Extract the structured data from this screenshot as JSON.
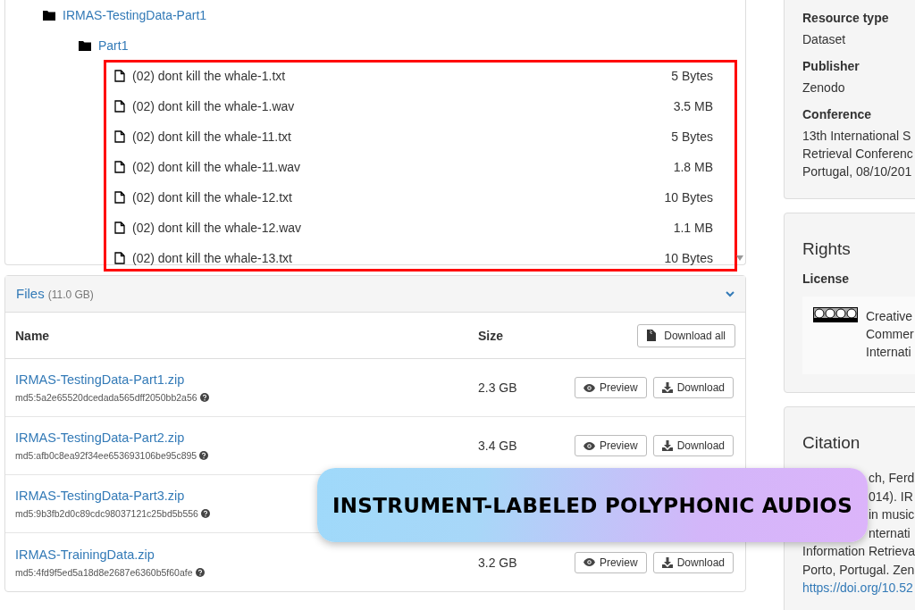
{
  "tree": [
    {
      "name": "IRMAS-TestingData-Part1",
      "kind": "folder",
      "children": [
        {
          "name": "Part1",
          "kind": "folder",
          "children": [
            {
              "name": "(02) dont kill the whale-1.txt",
              "kind": "file",
              "size": "5 Bytes"
            },
            {
              "name": "(02) dont kill the whale-1.wav",
              "kind": "file",
              "size": "3.5 MB"
            },
            {
              "name": "(02) dont kill the whale-11.txt",
              "kind": "file",
              "size": "5 Bytes"
            },
            {
              "name": "(02) dont kill the whale-11.wav",
              "kind": "file",
              "size": "1.8 MB"
            },
            {
              "name": "(02) dont kill the whale-12.txt",
              "kind": "file",
              "size": "10 Bytes"
            },
            {
              "name": "(02) dont kill the whale-12.wav",
              "kind": "file",
              "size": "1.1 MB"
            },
            {
              "name": "(02) dont kill the whale-13.txt",
              "kind": "file",
              "size": "10 Bytes"
            }
          ]
        }
      ]
    }
  ],
  "files": {
    "title": "Files",
    "total": "(11.0 GB)",
    "expanded": true,
    "columns": [
      "Name",
      "Size"
    ],
    "download_all": "Download all",
    "rows": [
      {
        "name": "IRMAS-TestingData-Part1.zip",
        "md5": "md5:5a2e65520dcedada565dff2050bb2a56",
        "size": "2.3 GB",
        "preview": "Preview",
        "download": "Download"
      },
      {
        "name": "IRMAS-TestingData-Part2.zip",
        "md5": "md5:afb0c8ea92f34ee653693106be95c895",
        "size": "3.4 GB",
        "preview": "Preview",
        "download": "Download"
      },
      {
        "name": "IRMAS-TestingData-Part3.zip",
        "md5": "md5:9b3fb2d0c89cdc98037121c25bd5b556"
      },
      {
        "name": "IRMAS-TrainingData.zip",
        "md5": "md5:4fd9f5ed5a18d8e2687e6360b5f60afe",
        "size": "3.2 GB",
        "preview": "Preview",
        "download": "Download"
      }
    ]
  },
  "details": [
    {
      "label": "Resource type",
      "lines": [
        "Dataset"
      ]
    },
    {
      "label": "Publisher",
      "lines": [
        "Zenodo"
      ]
    },
    {
      "label": "Conference",
      "lines": [
        "13th International S",
        "Retrieval Conferenc",
        "Portugal, 08/10/201"
      ]
    }
  ],
  "rights": {
    "title": "Rights",
    "license_label": "License",
    "license_lines": [
      "Creative",
      "Commer",
      "Internati"
    ]
  },
  "citation": {
    "title": "Citation",
    "lines": [
      {
        "text": "ch, Ferd",
        "covered": true
      },
      {
        "text": "014). IR",
        "covered": true
      },
      {
        "text": "in music",
        "covered": true
      },
      {
        "text": "nternati",
        "covered": true
      },
      {
        "text": "Information Retrieva",
        "covered": false
      },
      {
        "text": "Porto, Portugal. Zen",
        "covered": false
      }
    ],
    "link": "https://doi.org/10.52"
  },
  "banner": "INSTRUMENT-LABELED POLYPHONIC AUDIOS"
}
